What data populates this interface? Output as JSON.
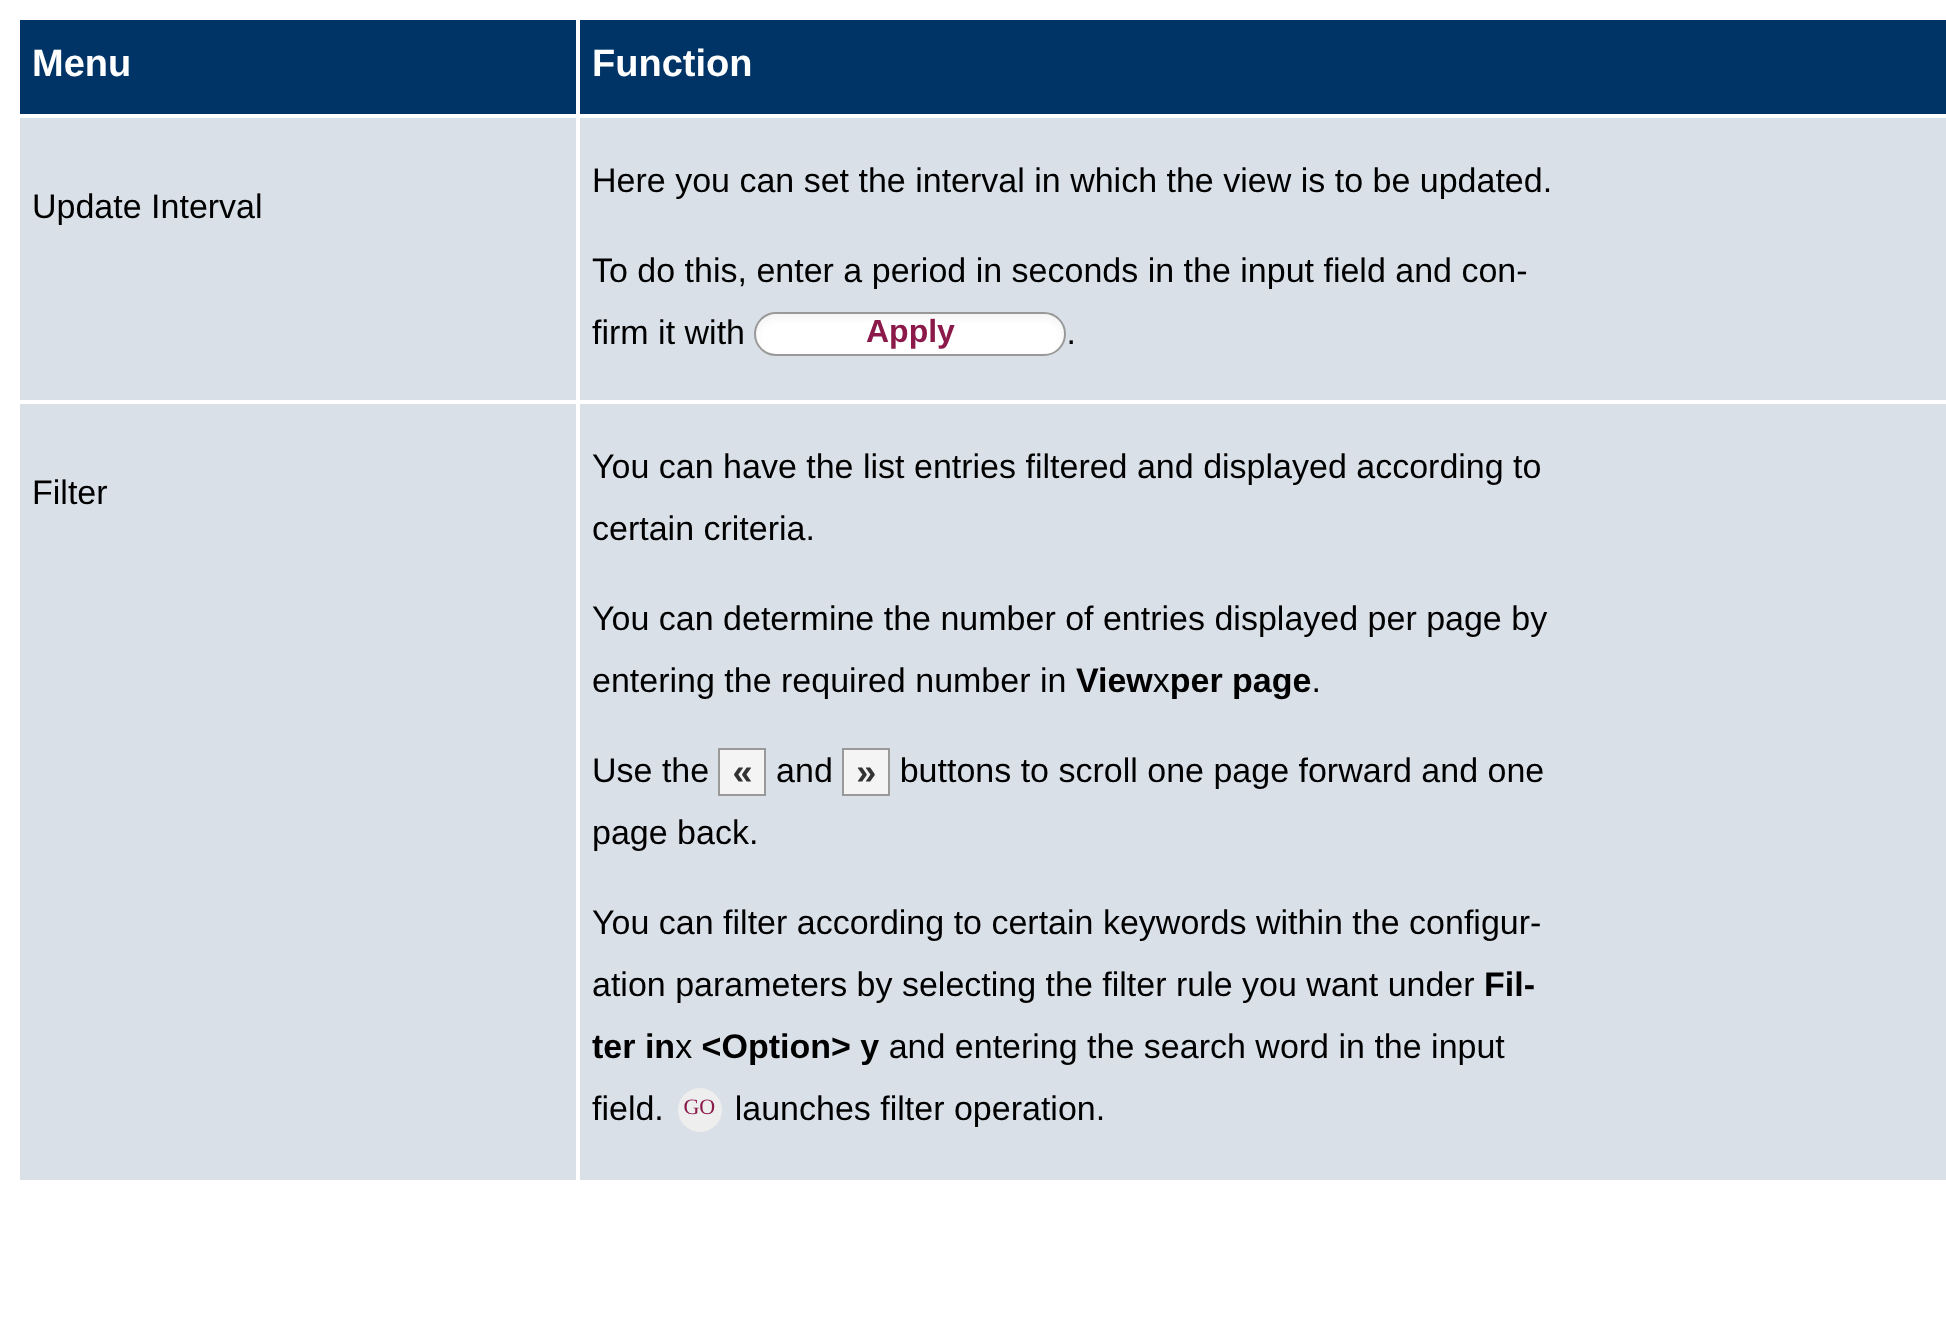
{
  "table": {
    "columns": [
      "Menu",
      "Function"
    ],
    "rows": [
      {
        "menu": "Update Interval",
        "paragraphs": [
          [
            [
              {
                "kind": "text",
                "text": "Here you can set the interval in which the view is to be updated."
              }
            ]
          ],
          [
            [
              {
                "kind": "text",
                "text": "To do this, enter a period in seconds in the input field and con-"
              }
            ],
            [
              {
                "kind": "text",
                "text": "firm it with "
              },
              {
                "kind": "pill",
                "text": "Apply"
              },
              {
                "kind": "text",
                "text": "."
              }
            ]
          ]
        ]
      },
      {
        "menu": "Filter",
        "paragraphs": [
          [
            [
              {
                "kind": "text",
                "text": "You can have the list entries filtered and displayed according to"
              }
            ],
            [
              {
                "kind": "text",
                "text": "certain criteria."
              }
            ]
          ],
          [
            [
              {
                "kind": "text",
                "text": "You can determine the number of entries displayed per page by"
              }
            ],
            [
              {
                "kind": "text",
                "text": "entering the required number in **View**x**per page**."
              }
            ]
          ],
          [
            [
              {
                "kind": "text",
                "text": "Use the "
              },
              {
                "kind": "square",
                "text": "«"
              },
              {
                "kind": "text",
                "text": " and "
              },
              {
                "kind": "square",
                "text": "»"
              },
              {
                "kind": "text",
                "text": " buttons to scroll one page forward and one"
              }
            ],
            [
              {
                "kind": "text",
                "text": "page back."
              }
            ]
          ],
          [
            [
              {
                "kind": "text",
                "text": "You can filter according to certain keywords within the configur-"
              }
            ],
            [
              {
                "kind": "text",
                "text": "ation parameters by selecting the filter rule you want under **Fil-**"
              }
            ],
            [
              {
                "kind": "text",
                "text": "**ter in**x **<Option> y** and entering the search word in the input"
              }
            ],
            [
              {
                "kind": "text",
                "text": "field. "
              },
              {
                "kind": "round",
                "text": "GO"
              },
              {
                "kind": "text",
                "text": " launches filter operation."
              }
            ]
          ]
        ]
      }
    ]
  }
}
